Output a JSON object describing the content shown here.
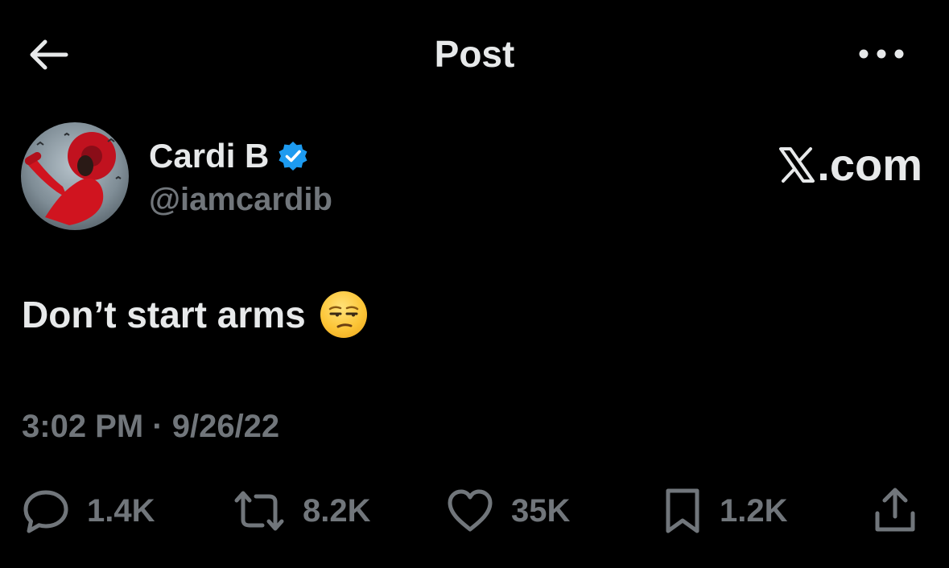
{
  "header": {
    "title": "Post",
    "back_icon": "arrow-left-icon",
    "more_icon": "ellipsis-icon"
  },
  "author": {
    "display_name": "Cardi B",
    "handle": "@iamcardib",
    "verified_icon": "verified-badge-icon",
    "verified_color": "#1d9bf0",
    "avatar": "profile-photo"
  },
  "brand": {
    "label": ".com",
    "logo_icon": "x-logo-icon"
  },
  "tweet": {
    "text": "Don’t start arms",
    "emoji": "unamused-face-emoji"
  },
  "meta": {
    "timestamp": "3:02 PM · 9/26/22"
  },
  "actions": {
    "replies": {
      "icon": "reply-icon",
      "count": "1.4K"
    },
    "reposts": {
      "icon": "repost-icon",
      "count": "8.2K"
    },
    "likes": {
      "icon": "heart-icon",
      "count": "35K"
    },
    "bookmarks": {
      "icon": "bookmark-icon",
      "count": "1.2K"
    },
    "share": {
      "icon": "share-icon"
    }
  },
  "colors": {
    "background": "#000000",
    "primary_text": "#e7e9ea",
    "secondary_text": "#71767b"
  }
}
